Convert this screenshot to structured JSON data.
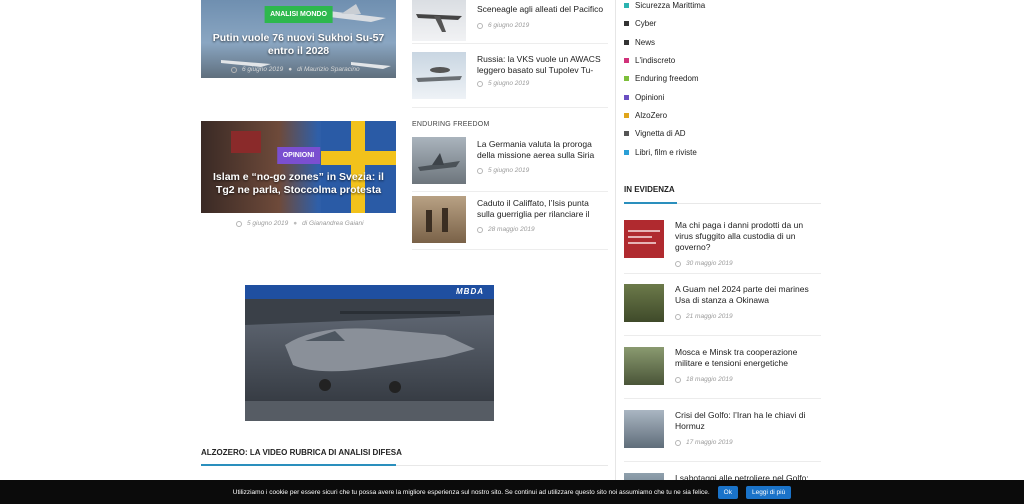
{
  "features": [
    {
      "category": "ANALISI MONDO",
      "category_color": "#2db84d",
      "title": "Putin vuole 76 nuovi Sukhoi Su-57 entro il 2028",
      "date": "6 giugno 2019",
      "author": "di Maurizio Sparacino"
    },
    {
      "category": "OPINIONI",
      "category_color": "#7a4fd0",
      "title": "Islam e “no-go zones” in Svezia: il Tg2 ne parla, Stoccolma protesta",
      "date": "5 giugno 2019",
      "author": "di Gianandrea Gaiani"
    }
  ],
  "mid_top": [
    {
      "title": "Sceneagle agli alleati del Pacifico",
      "date": "6 giugno 2019"
    },
    {
      "title": "Russia: la VKS vuole un AWACS leggero basato sul Tupolev Tu-",
      "date": "5 giugno 2019"
    }
  ],
  "enduring": {
    "label": "ENDURING FREEDOM",
    "items": [
      {
        "title": "La Germania valuta la proroga della missione aerea sulla Siria",
        "date": "5 giugno 2019"
      },
      {
        "title": "Caduto il Califfato, l’Isis punta sulla guerriglia per rilanciare il",
        "date": "28 maggio 2019"
      }
    ]
  },
  "categories": [
    {
      "label": "Sicurezza Marittima",
      "color": "#2bb3b0"
    },
    {
      "label": "Cyber",
      "color": "#333333"
    },
    {
      "label": "News",
      "color": "#333333"
    },
    {
      "label": "L'indiscreto",
      "color": "#d1327a"
    },
    {
      "label": "Enduring freedom",
      "color": "#7dbf3a"
    },
    {
      "label": "Opinioni",
      "color": "#6a4fc2"
    },
    {
      "label": "AlzoZero",
      "color": "#e0a51b"
    },
    {
      "label": "Vignetta di AD",
      "color": "#555555"
    },
    {
      "label": "Libri, film e riviste",
      "color": "#2a9fd6"
    }
  ],
  "evidenza": {
    "heading": "IN EVIDENZA",
    "items": [
      {
        "title": "Ma chi paga i danni prodotti da un virus sfuggito alla custodia di un governo?",
        "date": "30 maggio 2019"
      },
      {
        "title": "A Guam nel 2024 parte dei marines Usa di stanza a Okinawa",
        "date": "21 maggio 2019"
      },
      {
        "title": "Mosca e Minsk tra cooperazione militare e tensioni energetiche",
        "date": "18 maggio 2019"
      },
      {
        "title": "Crisi del Golfo: l’Iran ha le chiavi di Hormuz",
        "date": "17 maggio 2019"
      },
      {
        "title": "I sabotaggi alle petroliere nel Golfo:",
        "date": ""
      }
    ]
  },
  "ad": {
    "brand": "MBDA"
  },
  "alzozero_heading": "ALZOZERO: LA VIDEO RUBRICA DI ANALISI DIFESA",
  "cookie": {
    "text": "Utilizziamo i cookie per essere sicuri che tu possa avere la migliore esperienza sul nostro sito. Se continui ad utilizzare questo sito noi assumiamo che tu ne sia felice.",
    "ok": "Ok",
    "more": "Leggi di più"
  }
}
